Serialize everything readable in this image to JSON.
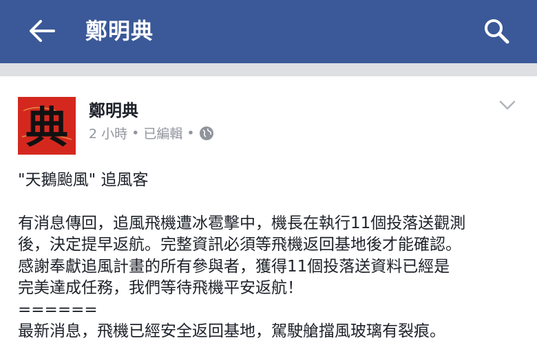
{
  "appbar": {
    "title": "鄭明典",
    "back_icon": "arrow-left-icon",
    "search_icon": "search-icon",
    "background": "#3b5998"
  },
  "post": {
    "author": "鄭明典",
    "avatar_glyph": "典",
    "timestamp": "2 小時",
    "edited": "已編輯",
    "separator": "•",
    "privacy_icon": "globe-icon",
    "menu_icon": "chevron-down-icon",
    "lines": [
      "\"天鵝颱風\" 追風客",
      "",
      "有消息傳回，追風飛機遭冰雹擊中，機長在執行11個投落送觀測",
      "後，決定提早返航。完整資訊必須等飛機返回基地後才能確認。",
      "感謝奉獻追風計畫的所有參與者，獲得11個投落送資料已經是",
      "完美達成任務，我們等待飛機平安返航！",
      "======",
      "最新消息，飛機已經安全返回基地，駕駛艙擋風玻璃有裂痕。"
    ]
  }
}
